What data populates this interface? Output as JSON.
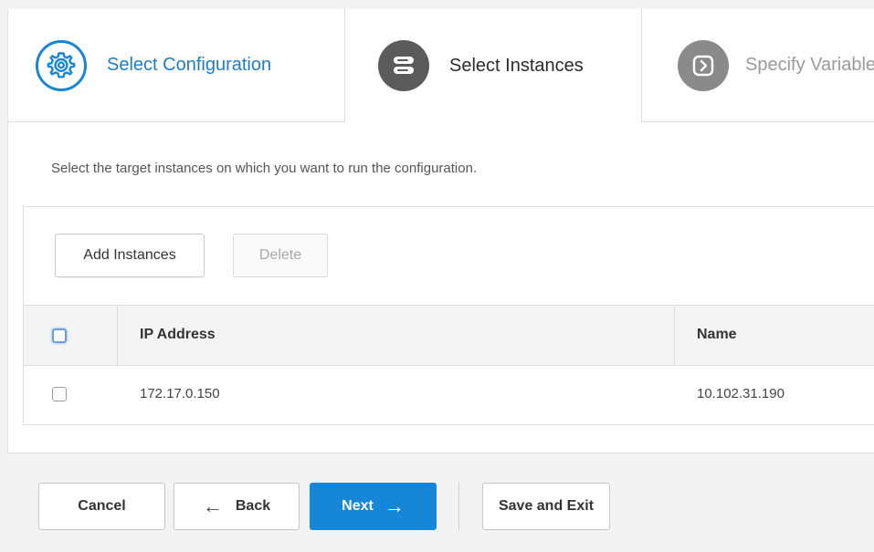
{
  "wizard": {
    "steps": [
      {
        "label": "Select Configuration",
        "icon": "gear-icon",
        "state": "completed"
      },
      {
        "label": "Select Instances",
        "icon": "server-icon",
        "state": "active"
      },
      {
        "label": "Specify Variable",
        "icon": "chevron-right-icon",
        "state": "pending"
      }
    ]
  },
  "main": {
    "description": "Select the target instances on which you want to run the configuration.",
    "toolbar": {
      "add_label": "Add Instances",
      "delete_label": "Delete"
    },
    "table": {
      "columns": [
        "IP Address",
        "Name"
      ],
      "rows": [
        {
          "ip": "172.17.0.150",
          "name": "10.102.31.190",
          "checked": false
        }
      ]
    }
  },
  "footer": {
    "cancel_label": "Cancel",
    "back_label": "Back",
    "next_label": "Next",
    "save_label": "Save and Exit"
  },
  "colors": {
    "accent": "#1587d6",
    "step_active_icon": "#5b5b5b",
    "step_pending_icon": "#8a8a8a"
  }
}
